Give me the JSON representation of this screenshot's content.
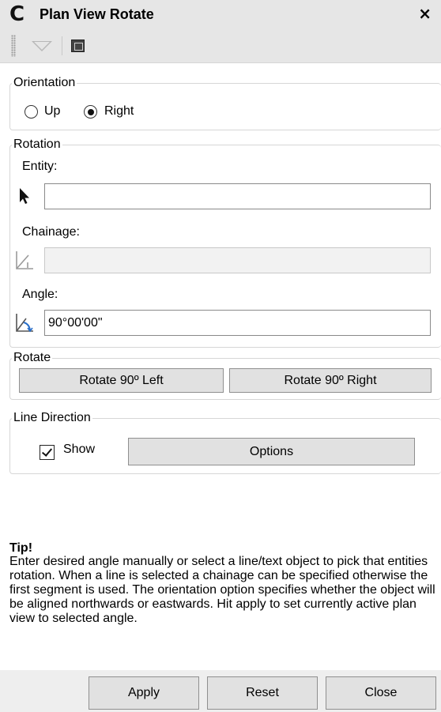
{
  "window": {
    "title": "Plan View Rotate",
    "app_icon_glyph": "C",
    "close_glyph": "×"
  },
  "toolbar": {
    "icons": [
      "toolbar-grip-icon",
      "dropdown-triangle-icon",
      "window-icon"
    ]
  },
  "orientation": {
    "legend": "Orientation",
    "options": [
      {
        "label": "Up",
        "checked": false
      },
      {
        "label": "Right",
        "checked": true
      }
    ]
  },
  "rotation": {
    "legend": "Rotation",
    "entity": {
      "label": "Entity:",
      "value": "",
      "icon": "select-arrow-icon"
    },
    "chainage": {
      "label": "Chainage:",
      "value": "",
      "disabled": true,
      "icon": "chainage-icon"
    },
    "angle": {
      "label": "Angle:",
      "value": "90°00'00\"",
      "icon": "angle-icon"
    }
  },
  "rotate": {
    "legend": "Rotate",
    "left_label": "Rotate 90º Left",
    "right_label": "Rotate 90º Right"
  },
  "line_direction": {
    "legend": "Line Direction",
    "show_label": "Show",
    "show_checked": true,
    "options_label": "Options"
  },
  "tip": {
    "title": "Tip!",
    "body": "Enter desired angle manually or select a line/text object to pick that entities rotation. When a line is selected a chainage can be specified otherwise the first segment is used. The orientation option specifies whether the object will be aligned northwards or eastwards. Hit apply to set currently active plan view to selected angle."
  },
  "footer": {
    "apply_label": "Apply",
    "reset_label": "Reset",
    "close_label": "Close"
  },
  "colors": {
    "titlebar_bg": "#e6e6e6",
    "button_bg": "#e1e1e1",
    "group_border": "#d6d6d6",
    "footer_bg": "#eeeeee"
  }
}
